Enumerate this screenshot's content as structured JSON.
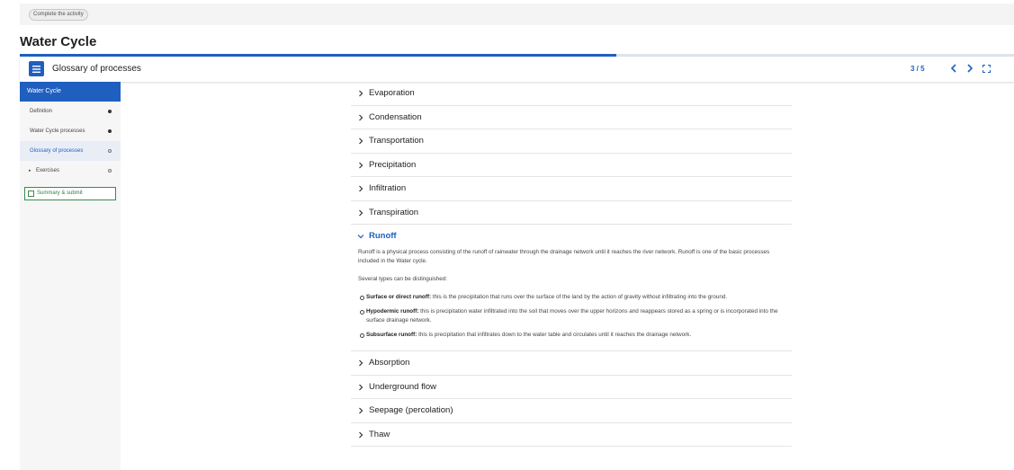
{
  "topbar": {
    "complete_label": "Complete the activity"
  },
  "page": {
    "title": "Water Cycle",
    "progress_fraction": 0.6
  },
  "header": {
    "section_title": "Glossary of processes",
    "pager": "3 / 5"
  },
  "sidebar": {
    "head": "Water Cycle",
    "items": [
      {
        "label": "Definition",
        "status": "filled"
      },
      {
        "label": "Water Cycle processes",
        "status": "filled"
      },
      {
        "label": "Glossary of processes",
        "status": "hollow"
      },
      {
        "label": "Exercises",
        "status": "hollow"
      }
    ],
    "summary_label": "Summary & submit"
  },
  "accordion": {
    "before": [
      "Evaporation",
      "Condensation",
      "Transportation",
      "Precipitation",
      "Infiltration",
      "Transpiration"
    ],
    "open": {
      "title": "Runoff",
      "intro": "Runoff is a physical process consisting of the runoff of rainwater through the drainage network until it reaches the river network. Runoff is one of the basic processes included in the Water cycle.",
      "lead": "Several types can be distinguished:",
      "types": [
        {
          "term": "Surface or direct runoff:",
          "text": " this is the precipitation that runs over the surface of the land by the action of gravity without infiltrating into the ground."
        },
        {
          "term": "Hypodermic runoff:",
          "text": " this is precipitation water infiltrated into the soil that moves over the upper horizons and reappears stored as a spring or is incorporated into the surface drainage network."
        },
        {
          "term": "Subsurface runoff:",
          "text": " this is precipitation that infiltrates down to the water table and circulates until it reaches the drainage network."
        }
      ]
    },
    "after": [
      "Absorption",
      "Underground flow",
      "Seepage (percolation)",
      "Thaw"
    ]
  },
  "colors": {
    "accent": "#1f5fbf",
    "success": "#3a8a50"
  }
}
